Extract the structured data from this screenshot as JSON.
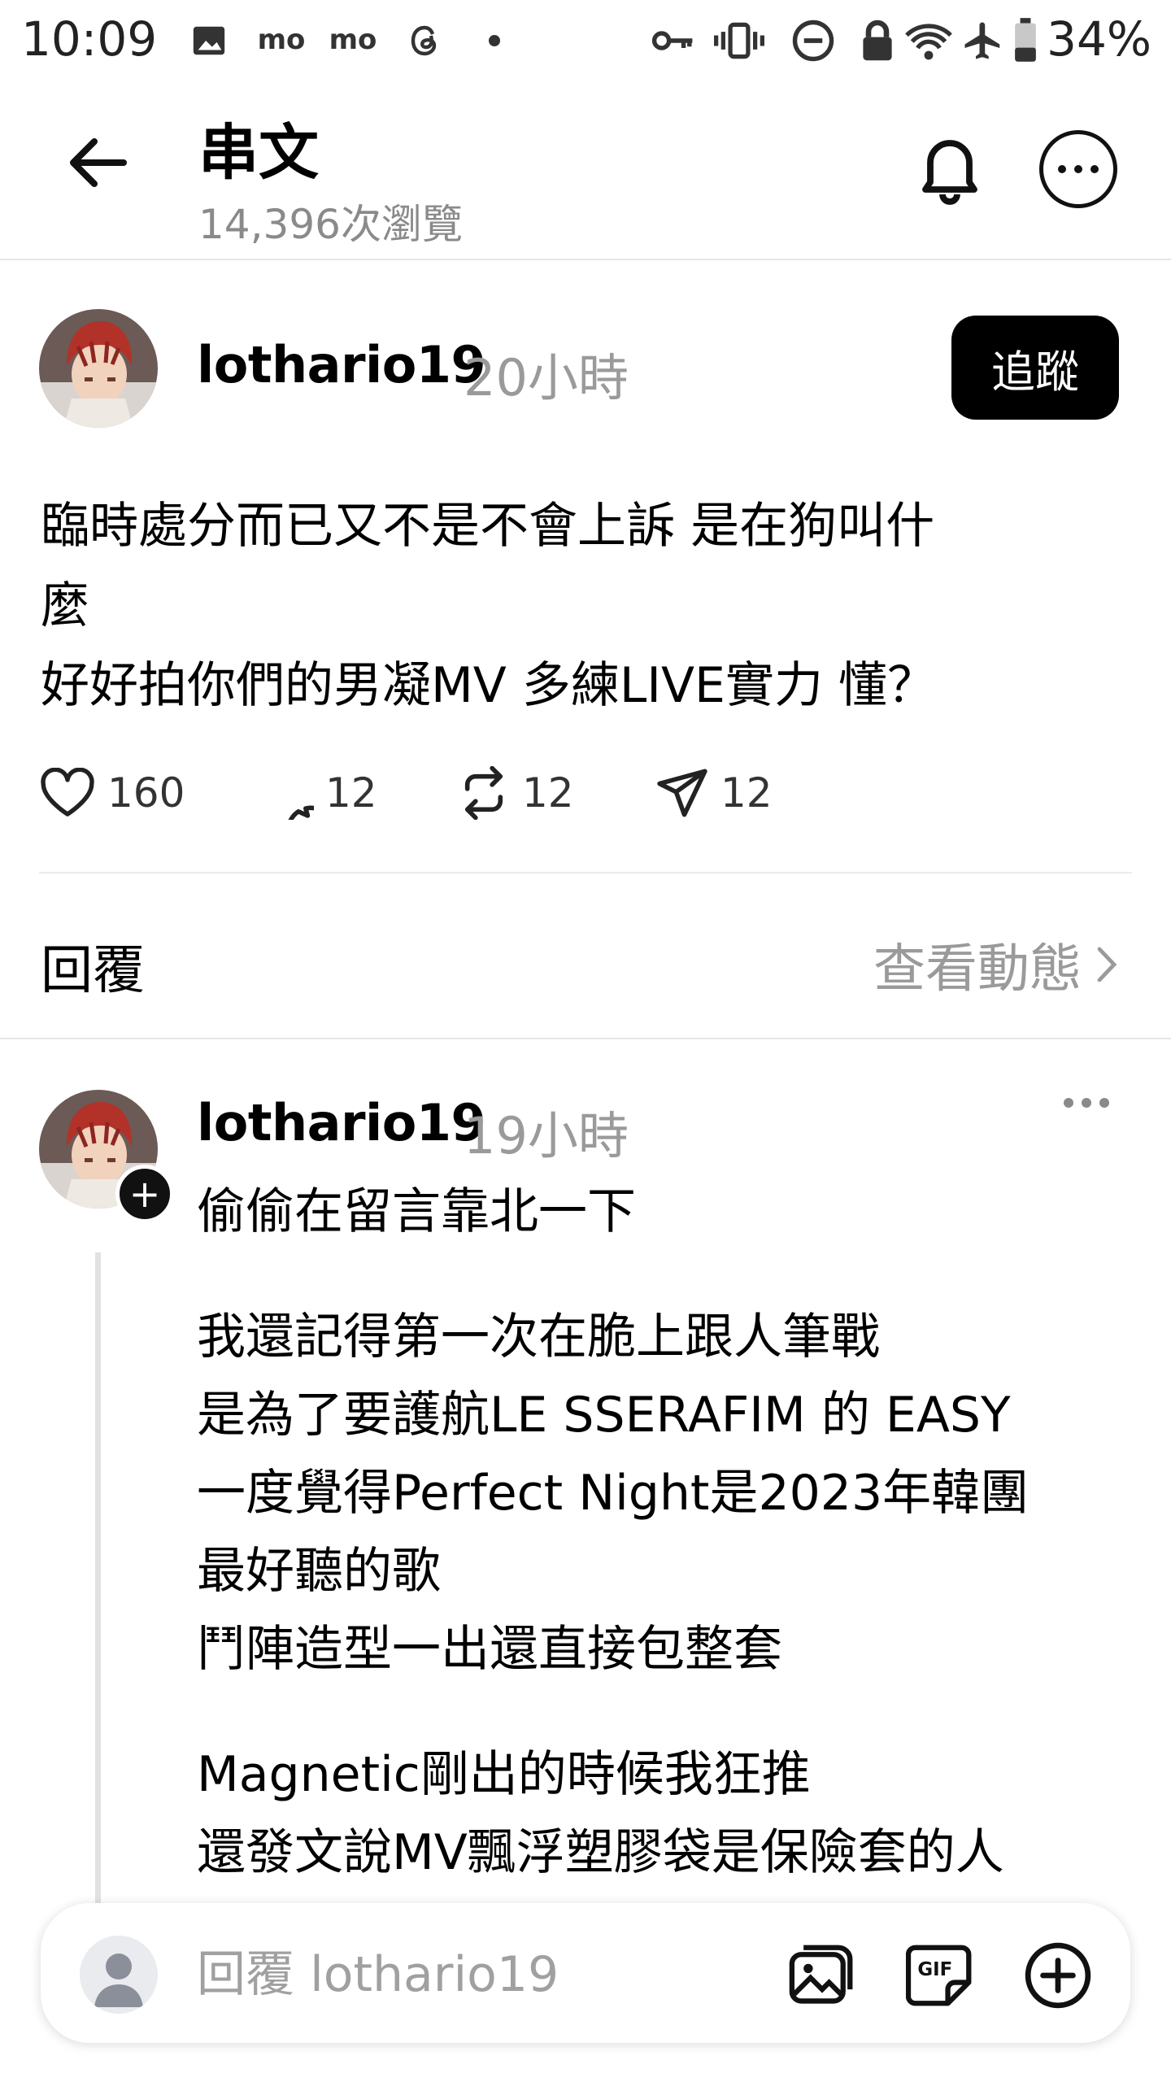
{
  "status_bar": {
    "time": "10:09",
    "battery": "34%",
    "icons": [
      "image-icon",
      "mo-icon",
      "mo-icon",
      "threads-icon",
      "dot-icon",
      "key-icon",
      "vibrate-icon",
      "dnd-icon",
      "lock-icon",
      "wifi-icon",
      "airplane-icon",
      "battery-icon"
    ],
    "left_badges": [
      "mo",
      "mo"
    ]
  },
  "header": {
    "title": "串文",
    "subtitle": "14,396次瀏覽",
    "icons": [
      "back-arrow-icon",
      "bell-icon",
      "more-icon"
    ]
  },
  "post": {
    "username": "lothario19",
    "time": "20小時",
    "follow_label": "追蹤",
    "body": "臨時處分而已又不是不會上訴 是在狗叫什\n麼\n好好拍你們的男凝MV 多練LIVE實力 懂？",
    "stats": {
      "likes": "160",
      "comments": "12",
      "reposts": "12",
      "shares": "12"
    }
  },
  "replies_section": {
    "title": "回覆",
    "activity_link": "查看動態"
  },
  "reply": {
    "username": "lothario19",
    "time": "19小時",
    "paragraphs": [
      "偷偷在留言靠北一下",
      "我還記得第一次在脆上跟人筆戰\n是為了要護航LE SSERAFIM 的 EASY\n一度覺得Perfect Night是2023年韓團\n最好聽的歌\n鬥陣造型一出還直接包整套",
      "Magnetic剛出的時候我狂推\n還發文說MV飄浮塑膠袋是保險套的人"
    ]
  },
  "composer": {
    "placeholder": "回覆 lothario19",
    "icons": [
      "gallery-icon",
      "gif-icon",
      "add-icon"
    ],
    "gif_text": "GIF"
  }
}
